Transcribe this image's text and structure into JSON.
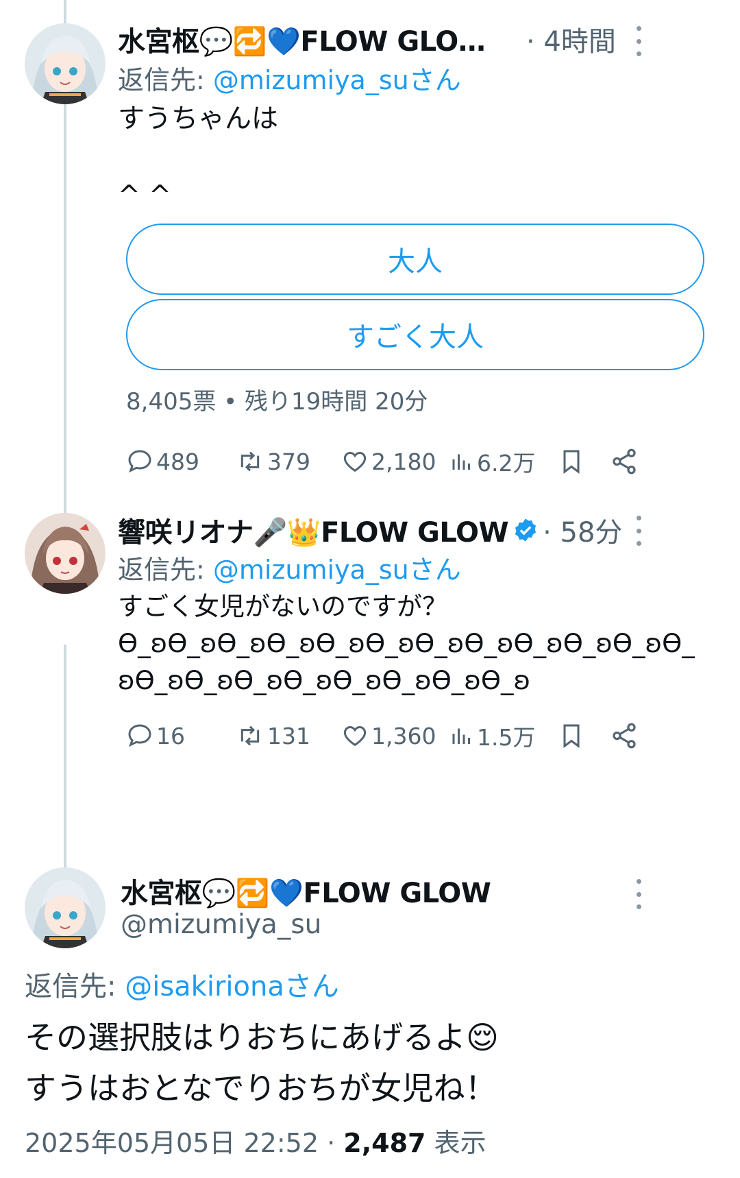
{
  "tweets": [
    {
      "author": "水宮枢💬🔁💙FLOW GLOW …",
      "time": "· 4時間",
      "reply_prefix": "返信先: ",
      "reply_handle": "@mizumiya_suさん",
      "text": "すうちゃんは\n\n^ ^",
      "poll": {
        "options": [
          "大人",
          "すごく大人"
        ],
        "meta": "8,405票 • 残り19時間 20分"
      },
      "stats": {
        "replies": "489",
        "retweets": "379",
        "likes": "2,180",
        "views": "6.2万"
      }
    },
    {
      "author": "響咲リオナ🎤👑FLOW GLOW",
      "verified": true,
      "time": "· 58分",
      "reply_prefix": "返信先: ",
      "reply_handle": "@mizumiya_suさん",
      "text": "すごく女児がないのですが？\nϴ_ʚϴ_ʚϴ_ʚϴ_ʚϴ_ʚϴ_ʚϴ_ʚϴ_ʚϴ_ʚϴ_ʚϴ_ʚϴ_\nʚϴ_ʚϴ_ʚϴ_ʚϴ_ʚϴ_ʚϴ_ʚϴ_ʚϴ_ʚ",
      "stats": {
        "replies": "16",
        "retweets": "131",
        "likes": "1,360",
        "views": "1.5万"
      }
    }
  ],
  "focus_tweet": {
    "author": "水宮枢💬🔁💙FLOW GLOW",
    "handle": "@mizumiya_su",
    "reply_prefix": "返信先: ",
    "reply_handle": "@isakirionaさん",
    "text_line1": "その選択肢はりおちにあげるよ😌",
    "text_line2": "すうはおとなでりおちが女児ね！",
    "date": "2025年05月05日 22:52",
    "dot": "·",
    "views_count": "2,487",
    "views_label": "表示"
  },
  "colors": {
    "accent": "#1d9bf0",
    "muted": "#536471",
    "thread_line": "#cfd9de"
  }
}
